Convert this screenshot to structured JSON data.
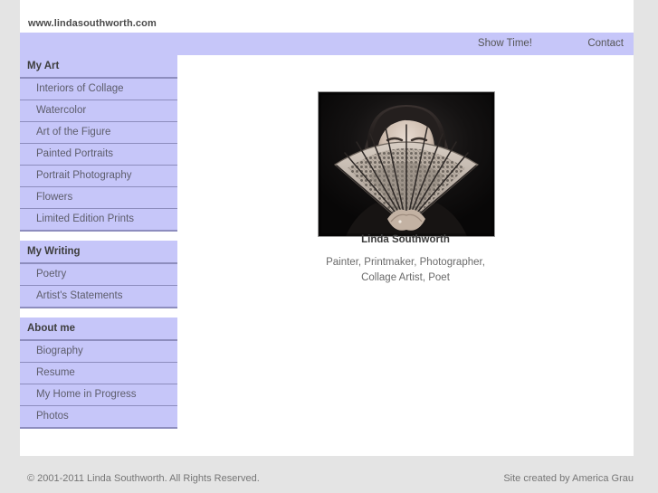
{
  "header": {
    "site_url": "www.lindasouthworth.com"
  },
  "topnav": {
    "items": [
      {
        "label": "Show Time!",
        "name": "show-time"
      },
      {
        "label": "Contact",
        "name": "contact"
      }
    ]
  },
  "sidebar": {
    "groups": [
      {
        "title": "My Art",
        "items": [
          "Interiors of Collage",
          "Watercolor",
          "Art of the Figure",
          "Painted Portraits",
          "Portrait Photography",
          "Flowers",
          "Limited Edition Prints"
        ]
      },
      {
        "title": "My Writing",
        "items": [
          "Poetry",
          "Artist's Statements"
        ]
      },
      {
        "title": "About me",
        "items": [
          "Biography",
          "Resume",
          "My Home in Progress",
          "Photos"
        ]
      }
    ]
  },
  "main": {
    "portrait_alt": "portrait-photo-woman-with-lace-fan",
    "artist_name": "Linda Southworth",
    "artist_roles_line1": "Painter, Printmaker, Photographer,",
    "artist_roles_line2": "Collage Artist, Poet"
  },
  "footer": {
    "copyright": "© 2001-2011 Linda Southworth. All Rights Reserved.",
    "credit": "Site created by America Grau"
  },
  "colors": {
    "lavender": "#c6c6f9",
    "separator": "#8d8dbe",
    "page_background": "#e4e4e4",
    "content_background": "#ffffff",
    "body_text": "#5d5d6b",
    "muted_text": "#767676"
  }
}
